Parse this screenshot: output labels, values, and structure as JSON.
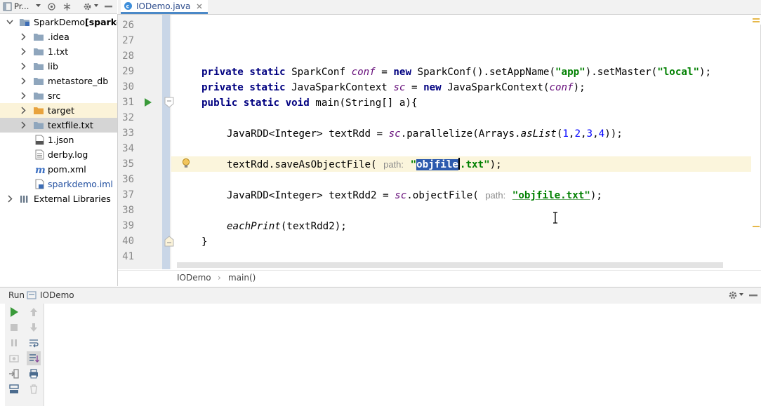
{
  "project_toolbar": {
    "title": "Pr..."
  },
  "project_tree": [
    {
      "label": "SparkDemo",
      "suffix": "[sparkd",
      "icon": "module-folder-icon"
    },
    {
      "label": ".idea",
      "icon": "folder-icon"
    },
    {
      "label": "1.txt",
      "icon": "folder-icon"
    },
    {
      "label": "lib",
      "icon": "folder-icon"
    },
    {
      "label": "metastore_db",
      "icon": "folder-icon"
    },
    {
      "label": "src",
      "icon": "folder-icon"
    },
    {
      "label": "target",
      "icon": "excluded-folder-icon"
    },
    {
      "label": "textfile.txt",
      "icon": "folder-icon"
    },
    {
      "label": "1.json",
      "icon": "json-file-icon"
    },
    {
      "label": "derby.log",
      "icon": "text-file-icon"
    },
    {
      "label": "pom.xml",
      "icon": "maven-icon"
    },
    {
      "label": "sparkdemo.iml",
      "icon": "iml-file-icon"
    },
    {
      "label": "External Libraries",
      "icon": "libraries-icon"
    }
  ],
  "editor": {
    "tab_title": "IODemo.java",
    "line_numbers": [
      "26",
      "27",
      "28",
      "29",
      "30",
      "31",
      "32",
      "33",
      "34",
      "35",
      "36",
      "37",
      "38",
      "39",
      "40",
      "41"
    ],
    "code": {
      "l29": {
        "k1": "private static",
        "t1": " SparkConf ",
        "f1": "conf",
        "t2": " = ",
        "k2": "new",
        "t3": " SparkConf().setAppName(",
        "s1": "\"app\"",
        "t4": ").setMaster(",
        "s2": "\"local\"",
        "t5": ");"
      },
      "l30": {
        "k1": "private static",
        "t1": " JavaSparkContext ",
        "f1": "sc",
        "t2": " = ",
        "k2": "new",
        "t3": " JavaSparkContext(",
        "f2": "conf",
        "t4": ");"
      },
      "l31": {
        "k1": "public static void",
        "t1": " main(String[] a){"
      },
      "l33": {
        "t1": "JavaRDD<Integer> textRdd = ",
        "f1": "sc",
        "t2": ".parallelize(Arrays.",
        "i1": "asList",
        "t3": "(",
        "n1": "1",
        "c1": ",",
        "n2": "2",
        "c2": ",",
        "n3": "3",
        "c3": ",",
        "n4": "4",
        "t4": "));"
      },
      "l35": {
        "t1": "textRdd.saveAsObjectFile(",
        "hint": "path:",
        "q1": "\"",
        "sel": "objfile",
        "s_rest": ".txt\"",
        "t2": ");"
      },
      "l37": {
        "t1": "JavaRDD<Integer> textRdd2 = ",
        "f1": "sc",
        "t2": ".objectFile(",
        "hint": "path:",
        "s1": "\"objfile.txt\"",
        "t3": ");"
      },
      "l39": {
        "i1": "eachPrint",
        "t1": "(textRdd2);"
      },
      "l40": {
        "t1": "}"
      }
    }
  },
  "breadcrumbs": {
    "class_name": "IODemo",
    "separator": "›",
    "method_name": "main()"
  },
  "run_panel": {
    "label": "Run",
    "config_name": "IODemo"
  },
  "colors": {
    "keyword": "#000080",
    "field": "#660e7a",
    "string": "#008000",
    "number": "#0000ff",
    "selection": "#2e5bae",
    "run_green": "#3a9a3a"
  }
}
